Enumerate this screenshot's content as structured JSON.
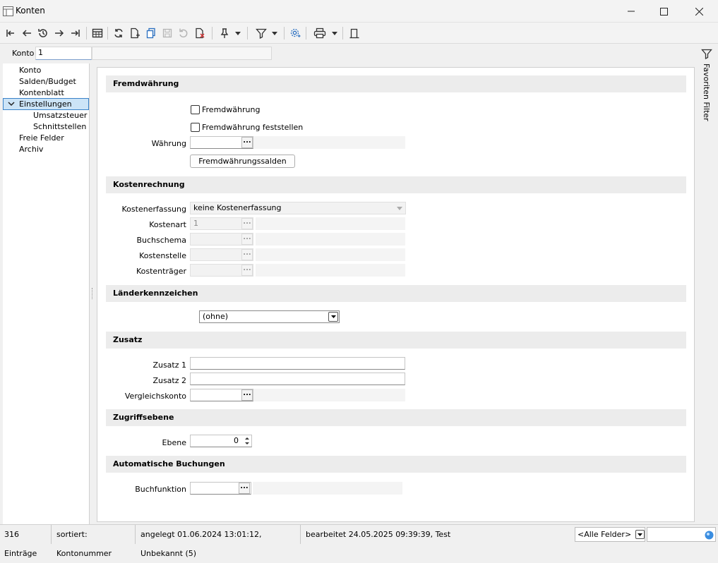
{
  "window": {
    "title": "Konten"
  },
  "konto": {
    "label": "Konto",
    "value": "1",
    "name": ""
  },
  "nav": {
    "items": [
      {
        "label": "Konto"
      },
      {
        "label": "Salden/Budget"
      },
      {
        "label": "Kontenblatt"
      },
      {
        "label": "Einstellungen"
      },
      {
        "label": "Umsatzsteuer"
      },
      {
        "label": "Schnittstellen"
      },
      {
        "label": "Freie Felder"
      },
      {
        "label": "Archiv"
      }
    ]
  },
  "filter_strip": {
    "label": "Favoriten Filter"
  },
  "sections": {
    "fremdwaehrung": {
      "title": "Fremdwährung",
      "chk_fremd": "Fremdwährung",
      "chk_fremd_checked": false,
      "chk_feststellen": "Fremdwährung feststellen",
      "chk_feststellen_checked": false,
      "waehrung_label": "Währung",
      "waehrung_value": "",
      "salden_button": "Fremdwährungssalden"
    },
    "kostenrechnung": {
      "title": "Kostenrechnung",
      "erfassung_label": "Kostenerfassung",
      "erfassung_value": "keine Kostenerfassung",
      "kostenart_label": "Kostenart",
      "kostenart_value": "1",
      "buchschema_label": "Buchschema",
      "kostenstelle_label": "Kostenstelle",
      "kostentraeger_label": "Kostenträger"
    },
    "laender": {
      "title": "Länderkennzeichen",
      "value": "(ohne)"
    },
    "zusatz": {
      "title": "Zusatz",
      "z1_label": "Zusatz 1",
      "z1_value": "",
      "z2_label": "Zusatz 2",
      "z2_value": "",
      "vergleich_label": "Vergleichskonto",
      "vergleich_value": ""
    },
    "zugriff": {
      "title": "Zugriffsebene",
      "ebene_label": "Ebene",
      "ebene_value": "0"
    },
    "auto": {
      "title": "Automatische Buchungen",
      "buchfunktion_label": "Buchfunktion",
      "buchfunktion_value": ""
    }
  },
  "ellipsis": "...",
  "status": {
    "entries": "316 Einträge",
    "sorted": "sortiert: Kontonummer",
    "created": "angelegt 01.06.2024 13:01:12, Unbekannt (5)",
    "edited": "bearbeitet 24.05.2025 09:39:39, Test",
    "field_filter": "<Alle Felder>",
    "search_value": ""
  }
}
